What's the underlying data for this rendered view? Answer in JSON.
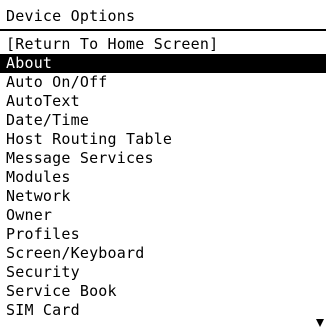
{
  "header": {
    "title": "Device Options"
  },
  "menu": {
    "selected_index": 1,
    "items": [
      {
        "label": "[Return To Home Screen]"
      },
      {
        "label": "About"
      },
      {
        "label": "Auto On/Off"
      },
      {
        "label": "AutoText"
      },
      {
        "label": "Date/Time"
      },
      {
        "label": "Host Routing Table"
      },
      {
        "label": "Message Services"
      },
      {
        "label": "Modules"
      },
      {
        "label": "Network"
      },
      {
        "label": "Owner"
      },
      {
        "label": "Profiles"
      },
      {
        "label": "Screen/Keyboard"
      },
      {
        "label": "Security"
      },
      {
        "label": "Service Book"
      },
      {
        "label": "SIM Card"
      }
    ]
  },
  "icons": {
    "scroll": "scroll-down-arrow-icon"
  },
  "colors": {
    "background": "#ffffff",
    "text": "#000000",
    "selection_background": "#000000",
    "selection_text": "#ffffff"
  }
}
